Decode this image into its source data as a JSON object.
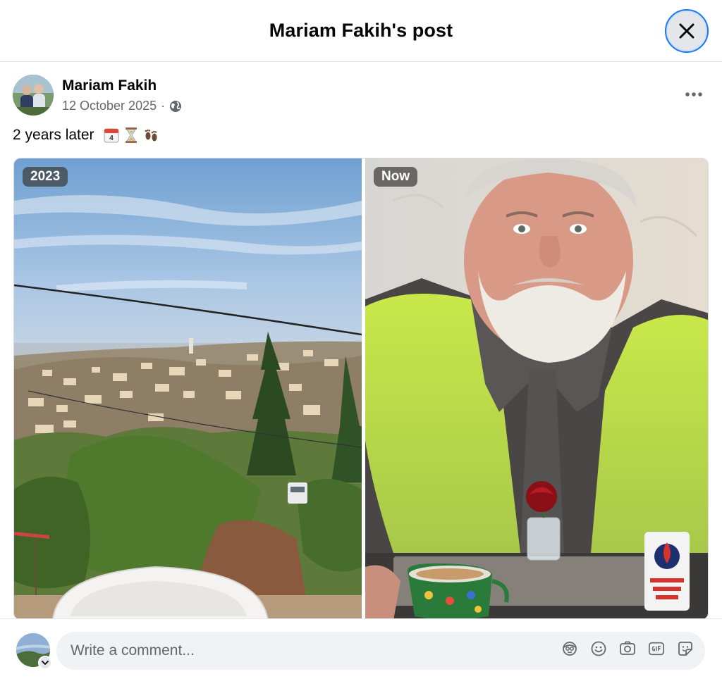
{
  "dialog": {
    "title": "Mariam Fakih's post"
  },
  "post": {
    "author": "Mariam Fakih",
    "date": "12 October 2025",
    "separator": "·",
    "audience_icon": "globe-icon",
    "text": "2 years later",
    "emojis": [
      "calendar-icon",
      "hourglass-icon",
      "footprints-icon"
    ],
    "photos": [
      {
        "badge": "2023",
        "subject": "village-landscape"
      },
      {
        "badge": "Now",
        "subject": "memorial-portrait"
      }
    ]
  },
  "comment": {
    "placeholder": "Write a comment...",
    "tools": [
      "avatar-sticker-icon",
      "emoji-icon",
      "camera-icon",
      "gif-icon",
      "sticker-icon"
    ]
  },
  "colors": {
    "accent": "#1877f2",
    "muted_text": "#65676b",
    "input_bg": "#f0f2f5",
    "button_bg": "#e4e6eb"
  }
}
